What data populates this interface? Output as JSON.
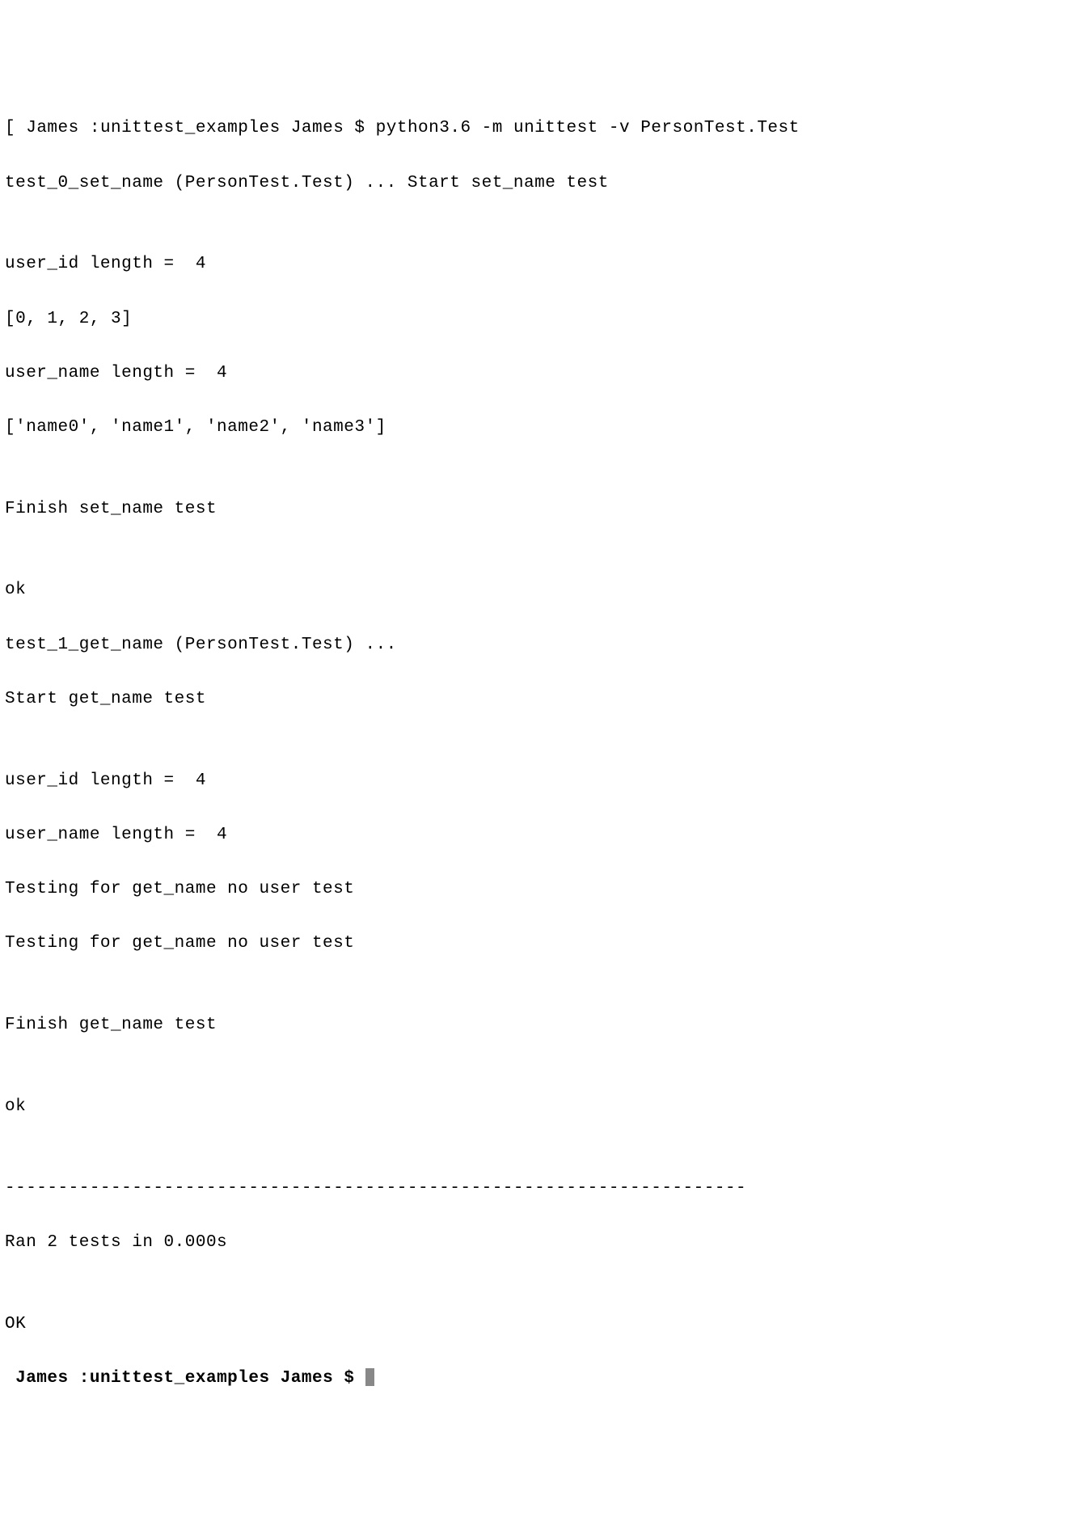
{
  "prompt1": {
    "open_bracket": "[ ",
    "user": "James",
    "colon": " :",
    "dir": "unittest_examples",
    "space_user": " James",
    "dollar": " $ ",
    "command": "python3.6 -m unittest -v PersonTest.Test"
  },
  "output": {
    "l01": "test_0_set_name (PersonTest.Test) ... Start set_name test",
    "l02": "",
    "l03": "user_id length =  4",
    "l04": "[0, 1, 2, 3]",
    "l05": "user_name length =  4",
    "l06": "['name0', 'name1', 'name2', 'name3']",
    "l07": "",
    "l08": "Finish set_name test",
    "l09": "",
    "l10": "ok",
    "l11": "test_1_get_name (PersonTest.Test) ... ",
    "l12": "Start get_name test",
    "l13": "",
    "l14": "user_id length =  4",
    "l15": "user_name length =  4",
    "l16": "Testing for get_name no user test",
    "l17": "Testing for get_name no user test",
    "l18": "",
    "l19": "Finish get_name test",
    "l20": "",
    "l21": "ok",
    "l22": "",
    "l23": "----------------------------------------------------------------------",
    "l24": "Ran 2 tests in 0.000s",
    "l25": "",
    "l26": "OK"
  },
  "prompt2": {
    "user": " James",
    "colon": " :",
    "dir": "unittest_examples",
    "space_user": " James",
    "dollar": " $ "
  }
}
